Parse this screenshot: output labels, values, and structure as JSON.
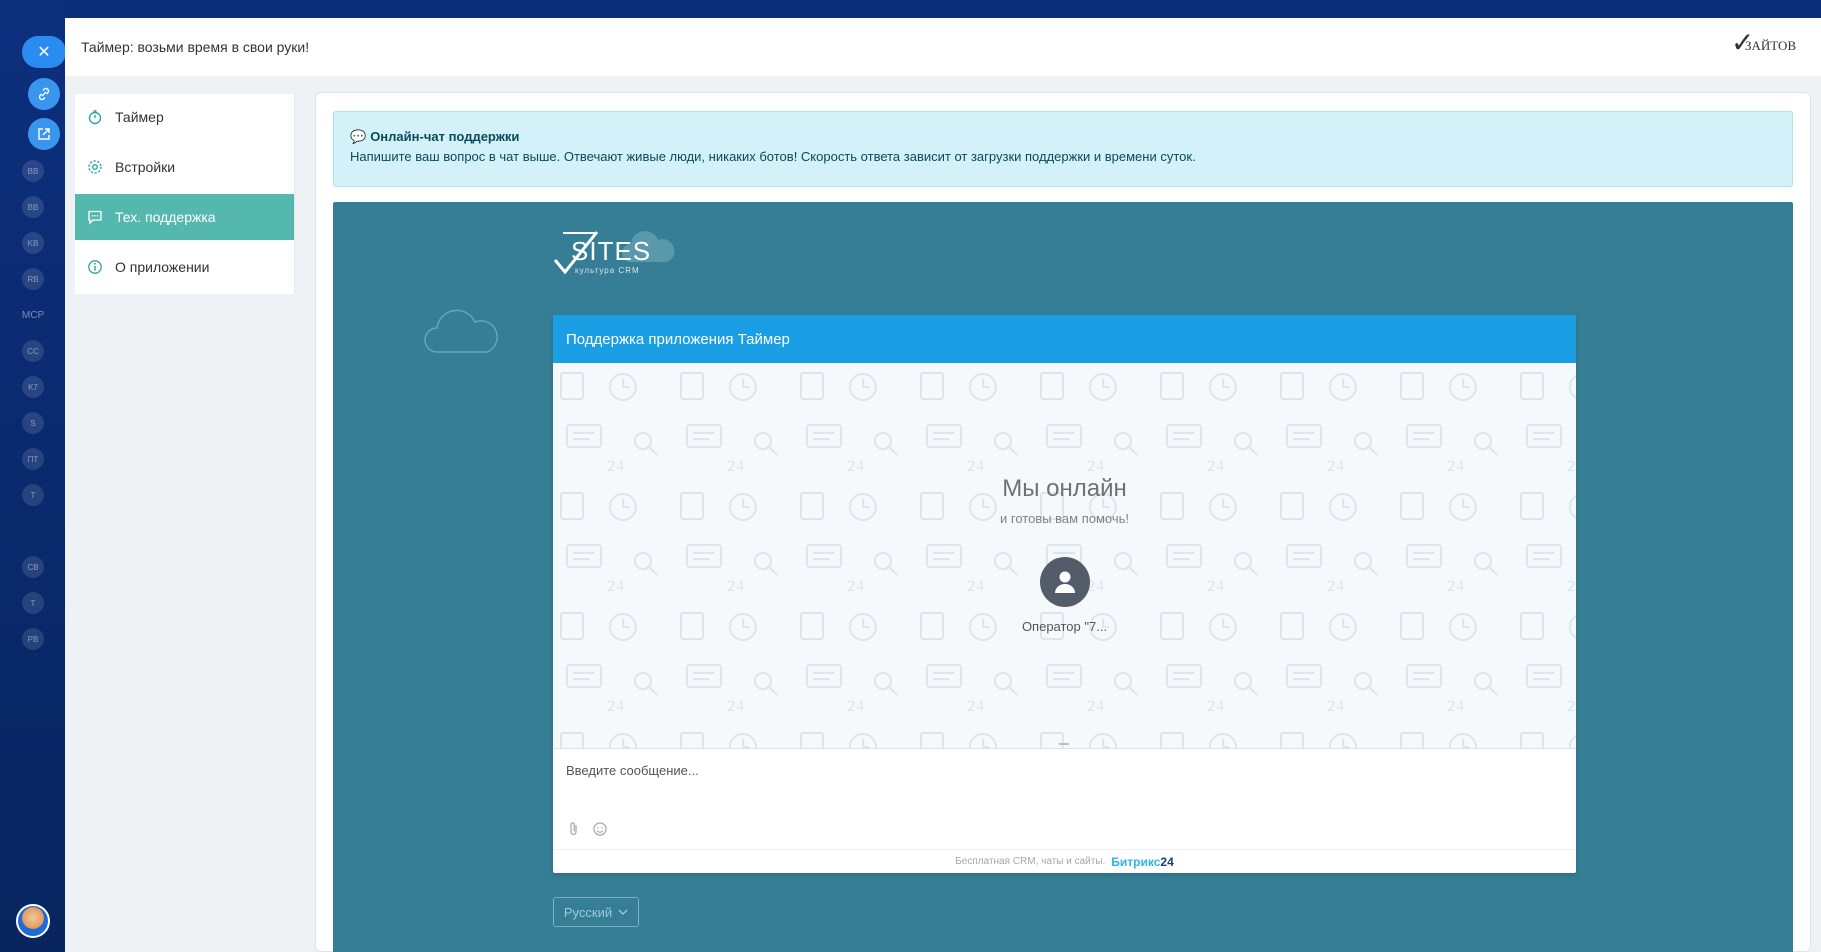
{
  "header": {
    "title": "Таймер: возьми время в свои руки!",
    "brand": "ЗАЙТОВ"
  },
  "rail": {
    "items": [
      "BB",
      "BB",
      "KB",
      "RB",
      "MCP",
      "CC",
      "K7",
      "S",
      "ПТ",
      "T",
      "СВ",
      "T",
      "PB"
    ]
  },
  "menu": {
    "items": [
      {
        "label": "Таймер",
        "icon": "stopwatch-icon"
      },
      {
        "label": "Встройки",
        "icon": "gear-icon"
      },
      {
        "label": "Тех. поддержка",
        "icon": "chat-bubble-icon",
        "active": true
      },
      {
        "label": "О приложении",
        "icon": "info-icon"
      }
    ]
  },
  "alert": {
    "title": "Онлайн-чат поддержки",
    "text": "Напишите ваш вопрос в чат выше. Отвечают живые люди, никаких ботов! Скорость ответа зависит от загрузки поддержки и времени суток."
  },
  "sites_logo": {
    "name": "SITES",
    "tagline": "культура CRM"
  },
  "chat": {
    "title": "Поддержка приложения Таймер",
    "online_title": "Мы онлайн",
    "online_subtitle": "и готовы вам помочь!",
    "operator": "Оператор \"7...",
    "input_placeholder": "Введите сообщение...",
    "footer_text": "Бесплатная CRM, чаты и сайты.",
    "footer_brand": "Битрикс",
    "footer_brand_num": "24"
  },
  "language": {
    "selected": "Русский"
  },
  "colors": {
    "accent": "#55b8ae",
    "chat_header": "#1a9ee4",
    "chat_area": "#367e95",
    "alert_bg": "#d2f1f8"
  }
}
